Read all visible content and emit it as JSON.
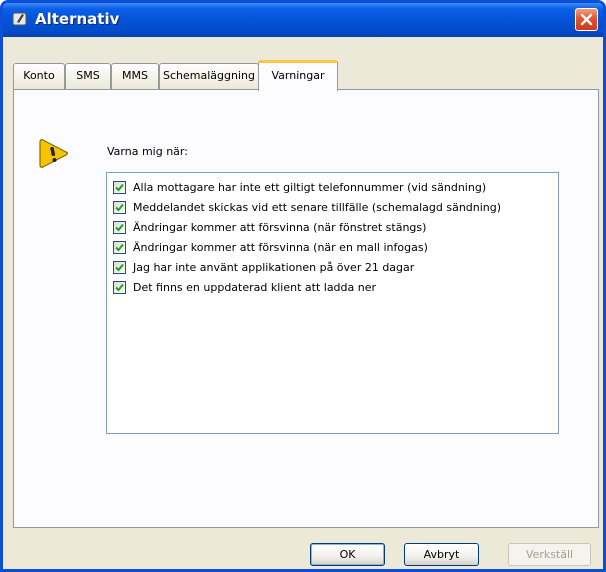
{
  "window": {
    "title": "Alternativ"
  },
  "tabs": [
    {
      "label": "Konto"
    },
    {
      "label": "SMS"
    },
    {
      "label": "MMS"
    },
    {
      "label": "Schemaläggning"
    },
    {
      "label": "Varningar"
    }
  ],
  "active_tab": "Varningar",
  "panel": {
    "heading": "Varna mig när:",
    "items": [
      {
        "label": "Alla mottagare har inte ett giltigt telefonnummer (vid sändning)",
        "checked": true
      },
      {
        "label": "Meddelandet skickas vid ett senare tillfälle (schemalagd sändning)",
        "checked": true
      },
      {
        "label": "Ändringar kommer att försvinna (när fönstret stängs)",
        "checked": true
      },
      {
        "label": "Ändringar kommer att försvinna (när en mall infogas)",
        "checked": true
      },
      {
        "label": "Jag har inte använt applikationen på över 21 dagar",
        "checked": true
      },
      {
        "label": "Det finns en uppdaterad klient att ladda ner",
        "checked": true
      }
    ]
  },
  "buttons": {
    "ok": "OK",
    "cancel": "Avbryt",
    "apply": "Verkställ"
  },
  "colors": {
    "titlebar": "#0553d9",
    "close": "#e2552f",
    "tab_highlight": "#ffc73c",
    "check": "#21a121",
    "warning": "#f5c400"
  }
}
